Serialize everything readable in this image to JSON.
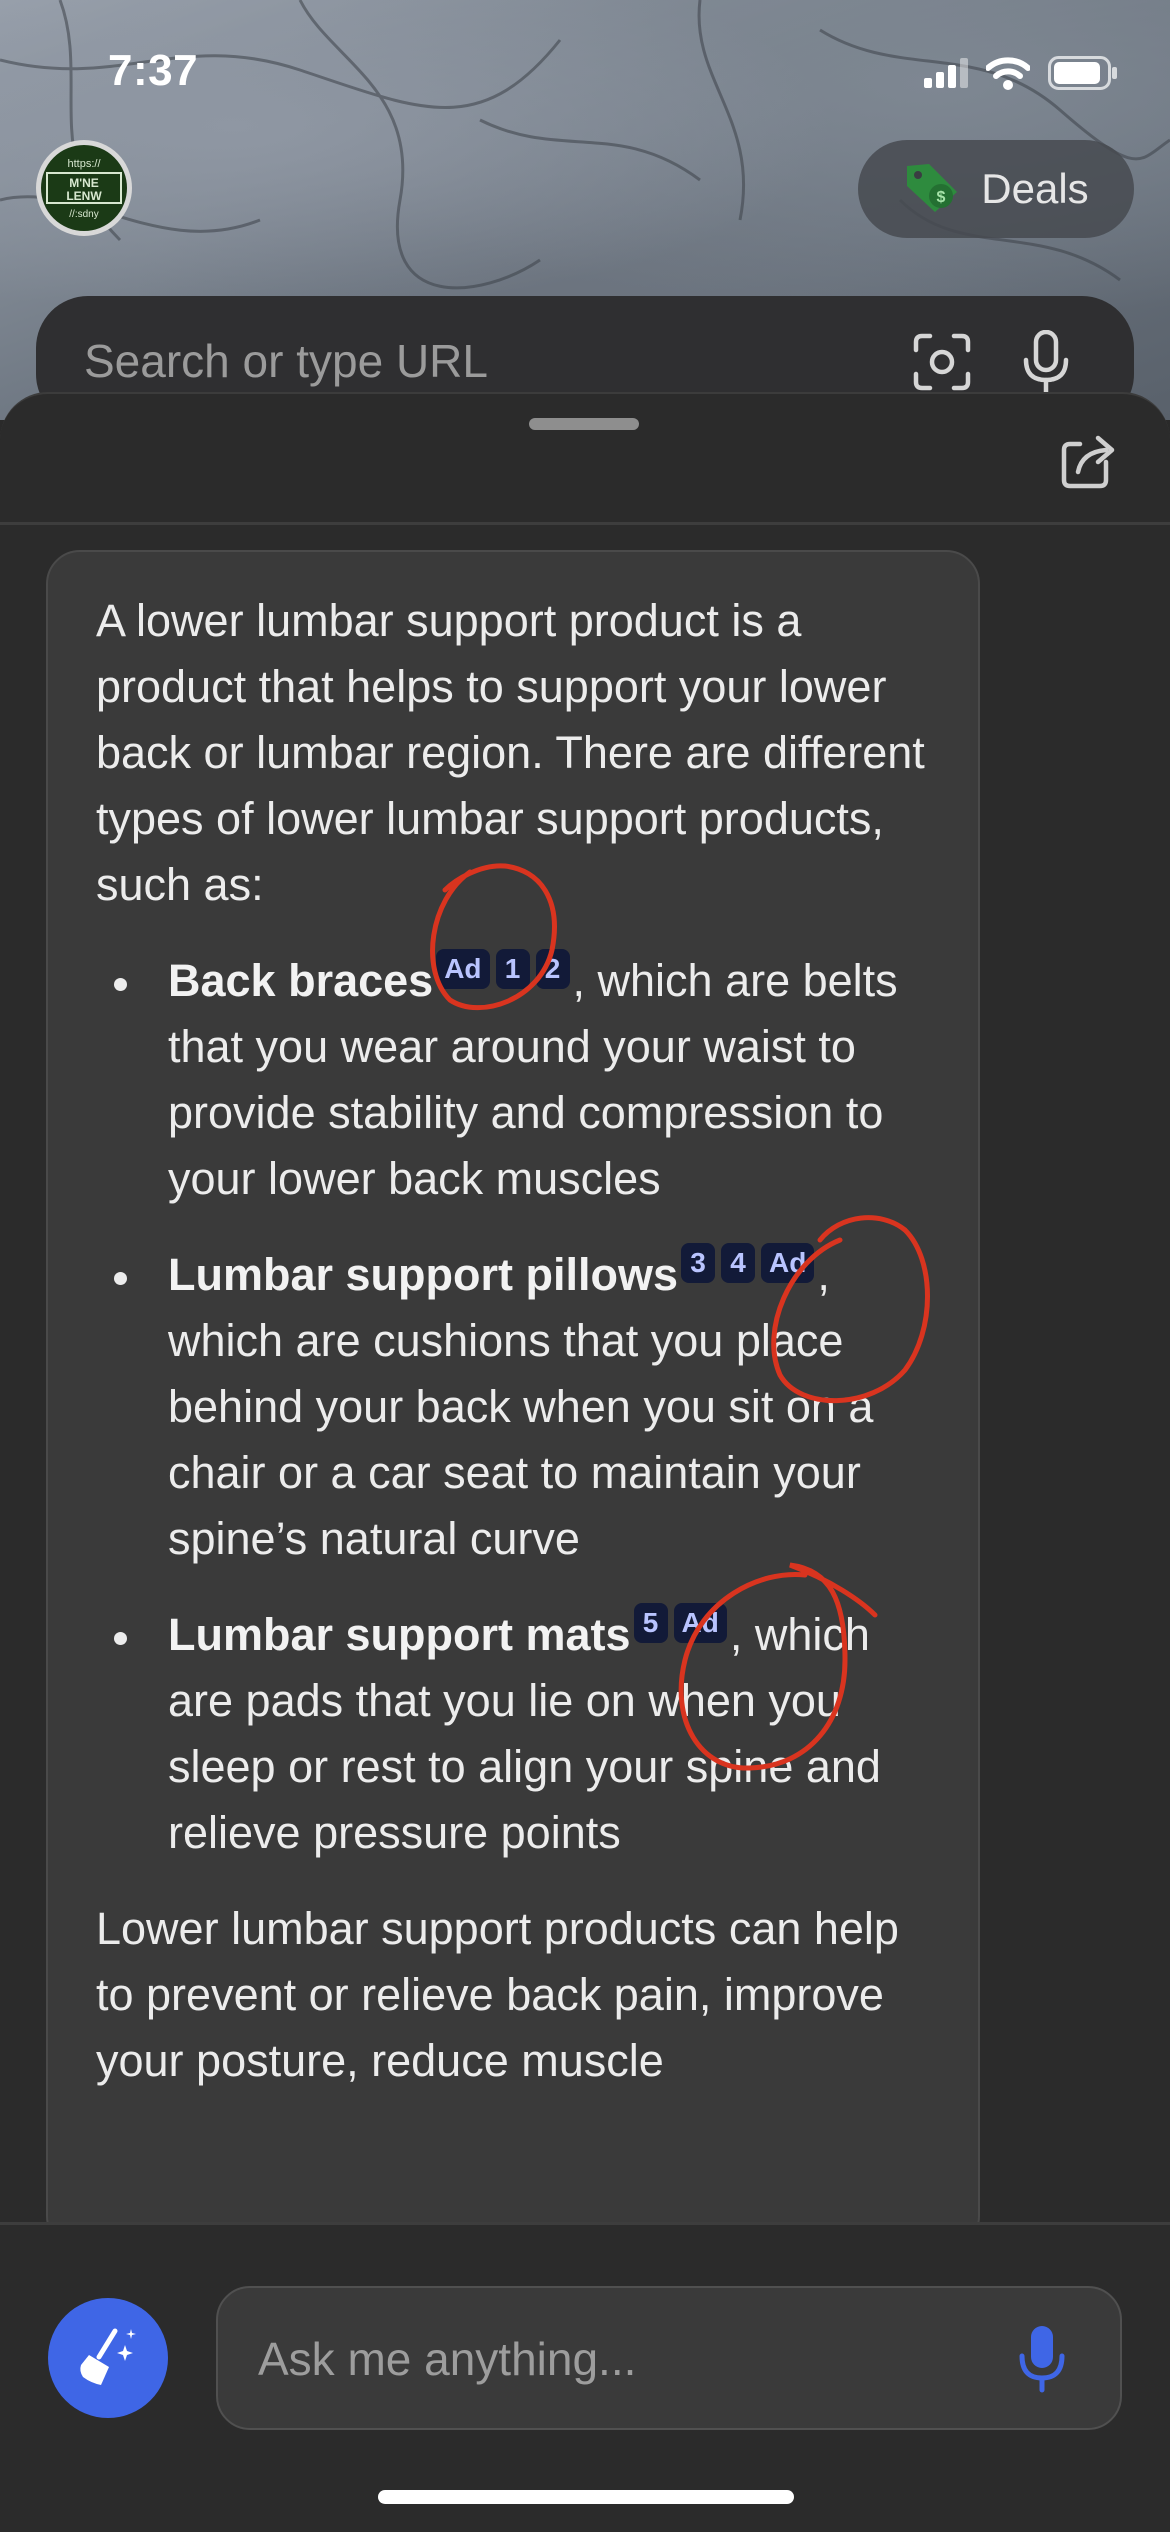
{
  "status_bar": {
    "time": "7:37"
  },
  "header": {
    "avatar_lines": [
      "https://",
      "M'NE",
      "LENW",
      "//:sdny"
    ],
    "deals_label": "Deals",
    "search_placeholder": "Search or type URL"
  },
  "answer": {
    "intro": "A lower lumbar support product is a product that helps to support your lower back or lumbar region. There are different types of lower lumbar support products, such as:",
    "items": [
      {
        "title": "Back braces",
        "citations": [
          "Ad",
          "1",
          "2"
        ],
        "text": ", which are belts that you wear around your waist to provide stability and compression to your lower back muscles"
      },
      {
        "title": "Lumbar support pillows",
        "citations": [
          "3",
          "4",
          "Ad"
        ],
        "text": ", which are cushions that you place behind your back when you sit on a chair or a car seat to maintain your spine’s natural curve"
      },
      {
        "title": "Lumbar support mats",
        "citations": [
          "5",
          "Ad"
        ],
        "text": ", which are pads that you lie on when you sleep or rest to align your spine and relieve pressure points"
      }
    ],
    "outro": "Lower lumbar support products can help to prevent or relieve back pain, improve your posture, reduce muscle"
  },
  "composer": {
    "placeholder": "Ask me anything..."
  },
  "colors": {
    "accent": "#3f66e6",
    "citation_bg": "#121a38",
    "citation_text": "#b9c4ff",
    "annotation_red": "#d9341f",
    "deals_icon": "#2e8b3e"
  },
  "icons": [
    "signal-icon",
    "wifi-icon",
    "battery-icon",
    "price-tag-icon",
    "scan-icon",
    "microphone-icon",
    "share-icon",
    "broom-sparkle-icon"
  ]
}
